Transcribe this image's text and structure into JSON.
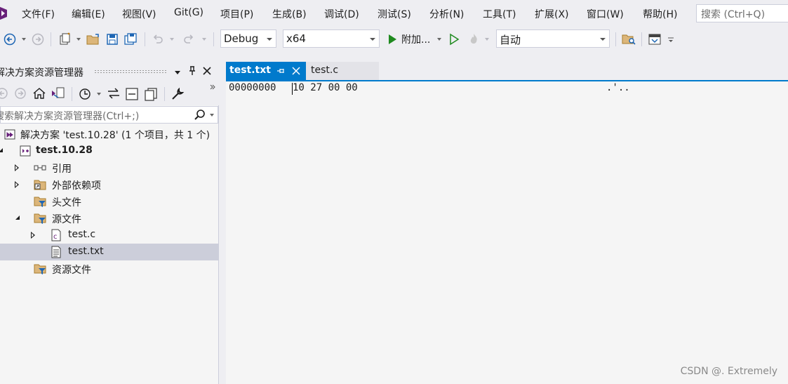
{
  "menu": [
    {
      "id": "file",
      "label": "文件(F)"
    },
    {
      "id": "edit",
      "label": "编辑(E)"
    },
    {
      "id": "view",
      "label": "视图(V)"
    },
    {
      "id": "git",
      "label": "Git(G)"
    },
    {
      "id": "project",
      "label": "项目(P)"
    },
    {
      "id": "build",
      "label": "生成(B)"
    },
    {
      "id": "debug",
      "label": "调试(D)"
    },
    {
      "id": "test",
      "label": "测试(S)"
    },
    {
      "id": "analyze",
      "label": "分析(N)"
    },
    {
      "id": "tools",
      "label": "工具(T)"
    },
    {
      "id": "extensions",
      "label": "扩展(X)"
    },
    {
      "id": "window",
      "label": "窗口(W)"
    },
    {
      "id": "help",
      "label": "帮助(H)"
    }
  ],
  "search": {
    "placeholder": "搜索 (Ctrl+Q)"
  },
  "toolbar": {
    "config": "Debug",
    "platform": "x64",
    "attach_label": "附加...",
    "target": "自动",
    "icons": [
      "back-icon",
      "forward-icon",
      "new-project-icon",
      "open-folder-icon",
      "save-icon",
      "save-all-icon",
      "undo-icon",
      "redo-icon",
      "start-icon",
      "start-without-debug-icon",
      "hot-reload-icon",
      "find-in-files-icon",
      "layout-icon"
    ]
  },
  "solution_explorer": {
    "title": "解决方案资源管理器",
    "search_placeholder": "搜索解决方案资源管理器(Ctrl+;)",
    "tree": [
      {
        "label": "解决方案 'test.10.28' (1 个项目，共 1 个)",
        "icon": "solution-icon",
        "expander": "none",
        "bold": false
      },
      {
        "label": "test.10.28",
        "icon": "project-icon",
        "expander": "open",
        "bold": true
      },
      {
        "label": "引用",
        "icon": "references-icon",
        "expander": "closed",
        "bold": false
      },
      {
        "label": "外部依赖项",
        "icon": "external-deps-icon",
        "expander": "closed",
        "bold": false
      },
      {
        "label": "头文件",
        "icon": "filter-folder-icon",
        "expander": "none",
        "bold": false
      },
      {
        "label": "源文件",
        "icon": "filter-folder-icon",
        "expander": "open",
        "bold": false
      },
      {
        "label": "test.c",
        "icon": "c-file-icon",
        "expander": "closed",
        "bold": false
      },
      {
        "label": "test.txt",
        "icon": "text-file-icon",
        "expander": "none",
        "bold": false,
        "selected": true
      },
      {
        "label": "资源文件",
        "icon": "filter-folder-icon",
        "expander": "none",
        "bold": false
      }
    ]
  },
  "editor": {
    "tabs": [
      {
        "label": "test.txt",
        "active": true
      },
      {
        "label": "test.c",
        "active": false
      }
    ],
    "hex_offset": "00000000",
    "hex_bytes": "10 27 00 00",
    "ascii": ".'.."
  },
  "watermark": "CSDN @. Extremely",
  "colors": {
    "accent": "#007acc",
    "selected_row": "#ccceda",
    "background": "#eeeef2"
  }
}
